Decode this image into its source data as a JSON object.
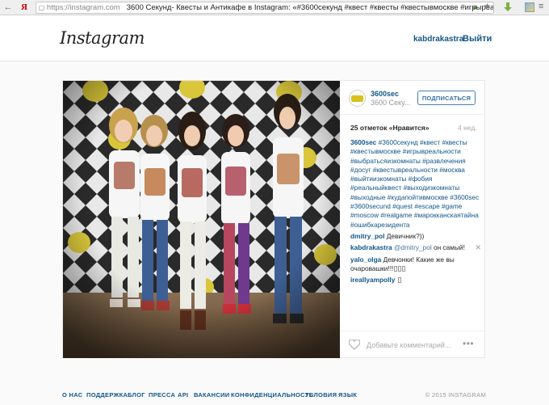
{
  "browser": {
    "back_icon": "back-arrow-icon",
    "yandex": "Я",
    "url": "https://instagram.com",
    "title": "3600 Секунд- Квесты и Антикафе в Instagram: «#3600секунд #квест #квесты #квестывмоскве #игрыреальност..."
  },
  "header": {
    "logo": "Instagram",
    "username": "kabdrakastra",
    "logout": "Выйти"
  },
  "post": {
    "owner": "3600sec",
    "owner_sub": "3600 Секу...",
    "follow": "ПОДПИСАТЬСЯ",
    "likes": "25 отметок «Нравится»",
    "age": "4 нед.",
    "caption_user": "3600sec",
    "caption": "#3600секунд #квест #квесты #квестывмоскве #игрывреальности #выбратьсяизкомнаты #развлечения #досуг #квестывреальности #москва #выйтиизкомнаты #фобия #реальныйквест #выходизкомнаты #выходные #кудапойтивмоскве #3600sec #3600secund #quest #escape #game #moscow #realgame #марокканскаятайна #ошибкарезидента",
    "comments": [
      {
        "user": "dmitry_pol",
        "text": "Девичник?))"
      },
      {
        "user": "kabdrakastra",
        "mention": "@dmitry_pol",
        "text": "он самый!"
      },
      {
        "user": "yalo_olga",
        "text": "Девчонки! Какие же вы очаровашки!!!"
      },
      {
        "user": "ireallyampolly",
        "text": ""
      }
    ],
    "comment_placeholder": "Добавьте комментарий...",
    "more": "•••"
  },
  "footer": {
    "links": [
      "О НАС",
      "ПОДДЕРЖКА",
      "БЛОГ",
      "ПРЕССА",
      "API",
      "ВАКАНСИИ",
      "КОНФИДЕНЦИАЛЬНОСТЬ",
      "УСЛОВИЯ",
      "ЯЗЫК"
    ],
    "copyright": "© 2015 INSTAGRAM"
  },
  "colors": {
    "link": "#125688",
    "follow_border": "#4a7fb0",
    "backdrop_yellow": "#d9c63a"
  }
}
